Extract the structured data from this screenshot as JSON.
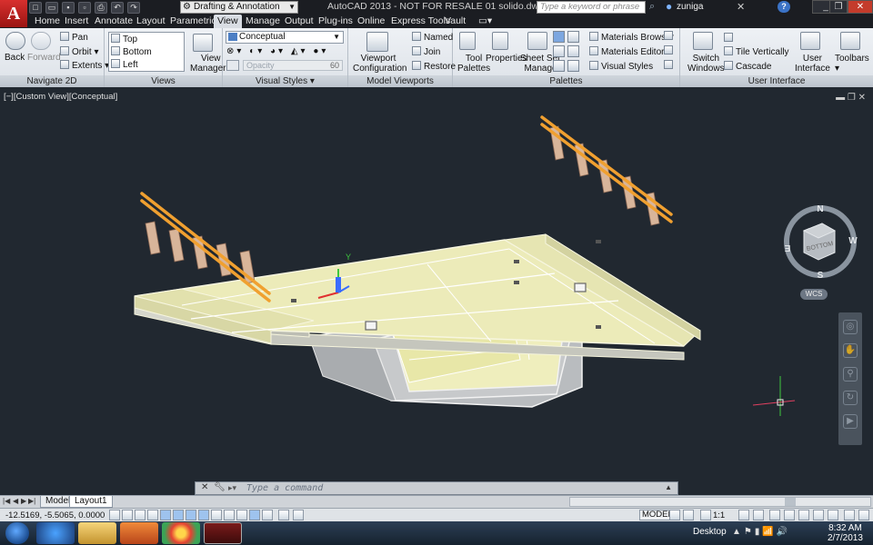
{
  "titlebar": {
    "app_logo_letter": "A",
    "workspace": "Drafting & Annotation",
    "app_title": "AutoCAD 2013 - NOT FOR RESALE    01 solido.dwg",
    "search_placeholder": "Type a keyword or phrase",
    "user_name": "zuniga"
  },
  "menu_tabs": [
    "Home",
    "Insert",
    "Annotate",
    "Layout",
    "Parametric",
    "View",
    "Manage",
    "Output",
    "Plug-ins",
    "Online",
    "Express Tools",
    "Vault"
  ],
  "active_tab": "View",
  "ribbon": {
    "navigate": {
      "title": "Navigate 2D",
      "back": "Back",
      "forward": "Forward",
      "pan": "Pan",
      "orbit": "Orbit",
      "extents": "Extents"
    },
    "views": {
      "title": "Views",
      "list": [
        "Top",
        "Bottom",
        "Left"
      ],
      "view_manager_line1": "View",
      "view_manager_line2": "Manager"
    },
    "visual_styles": {
      "title": "Visual Styles",
      "current": "Conceptual",
      "opacity_label": "Opacity",
      "opacity_value": "60"
    },
    "model_viewports": {
      "title": "Model Viewports",
      "config_line1": "Viewport",
      "config_line2": "Configuration",
      "named": "Named",
      "join": "Join",
      "restore": "Restore"
    },
    "palettes": {
      "title": "Palettes",
      "tool_palettes_line1": "Tool",
      "tool_palettes_line2": "Palettes",
      "properties": "Properties",
      "sheet_set_line1": "Sheet Set",
      "sheet_set_line2": "Manager",
      "materials_browser": "Materials Browser",
      "materials_editor": "Materials Editor",
      "visual_styles": "Visual Styles"
    },
    "user_interface": {
      "title": "User Interface",
      "switch_line1": "Switch",
      "switch_line2": "Windows",
      "tile_vertically": "Tile Vertically",
      "cascade": "Cascade",
      "user_interface_line1": "User",
      "user_interface_line2": "Interface",
      "toolbars": "Toolbars"
    }
  },
  "viewport": {
    "label": "[−][Custom View][Conceptual]",
    "viewcube_face": "BOTTOM",
    "compass": {
      "n": "N",
      "s": "S",
      "e": "E",
      "w": "W"
    },
    "wcs": "WCS"
  },
  "command_line": {
    "placeholder": "Type a command"
  },
  "layout_tabs": [
    "Model",
    "Layout1"
  ],
  "statusbar": {
    "coordinates": "-12.5169, -5.5065, 0.0000",
    "space": "MODEL",
    "annotation_scale": "1:1"
  },
  "taskbar": {
    "desktop_label": "Desktop",
    "time": "8:32 AM",
    "date": "2/7/2013"
  },
  "colors": {
    "viewport_bg": "#212830",
    "deck_fill": "#e8e6b4",
    "deck_edge": "#f5f4dc",
    "railing": "#f0a030",
    "post": "#d8b59a",
    "concrete_side": "#bfc0c2"
  }
}
